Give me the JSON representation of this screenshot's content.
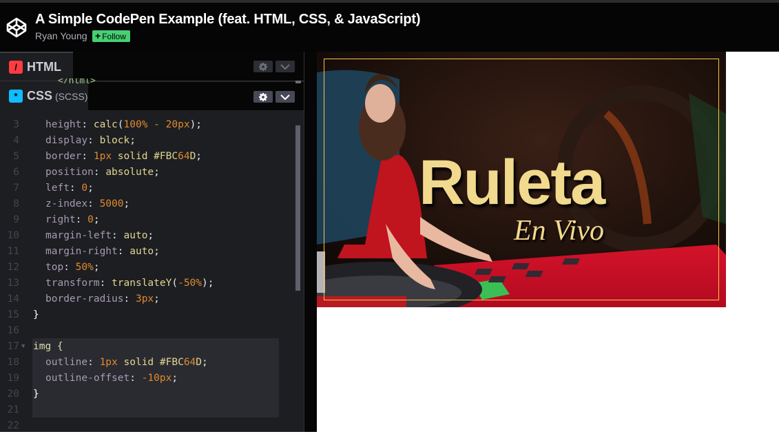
{
  "header": {
    "logo_icon": "codepen-logo-icon",
    "title": "A Simple CodePen Example (feat. HTML, CSS, & JavaScript)",
    "author": "Ryan Young",
    "follow_label": "Follow",
    "follow_icon": "plus-icon"
  },
  "panes": {
    "html": {
      "label": "HTML",
      "icon": "html-icon",
      "icon_glyph": "/",
      "icon_color": "#ff3c41",
      "peek_text": "</html>"
    },
    "css": {
      "label": "CSS",
      "sublabel": "(SCSS)",
      "icon": "css-icon",
      "icon_glyph": "*",
      "icon_color": "#0ebeff"
    }
  },
  "code": {
    "lines": [
      {
        "num": "3",
        "prop": "height",
        "value": "calc(100% - 20px);"
      },
      {
        "num": "4",
        "prop": "display",
        "value": "block;"
      },
      {
        "num": "5",
        "prop": "border",
        "value": "1px solid #FBC64D;"
      },
      {
        "num": "6",
        "prop": "position",
        "value": "absolute;"
      },
      {
        "num": "7",
        "prop": "left",
        "value": "0;"
      },
      {
        "num": "8",
        "prop": "z-index",
        "value": "5000;"
      },
      {
        "num": "9",
        "prop": "right",
        "value": "0;"
      },
      {
        "num": "10",
        "prop": "margin-left",
        "value": "auto;"
      },
      {
        "num": "11",
        "prop": "margin-right",
        "value": "auto;"
      },
      {
        "num": "12",
        "prop": "top",
        "value": "50%;"
      },
      {
        "num": "13",
        "prop": "transform",
        "value": "translateY(-50%);"
      },
      {
        "num": "14",
        "prop": "border-radius",
        "value": "3px;"
      },
      {
        "num": "15",
        "text": "}"
      },
      {
        "num": "16",
        "text": ""
      },
      {
        "num": "17",
        "text": "img {"
      },
      {
        "num": "18",
        "prop": "outline",
        "value": "1px solid #FBC64D;"
      },
      {
        "num": "19",
        "prop": "outline-offset",
        "value": "-10px;"
      },
      {
        "num": "20",
        "text": "}"
      },
      {
        "num": "21",
        "text": ""
      },
      {
        "num": "22",
        "text": ""
      }
    ]
  },
  "preview": {
    "image_alt": "Ruleta En Vivo live roulette dealer banner",
    "title_text": "Ruleta",
    "subtitle_text": "En Vivo",
    "outline_color": "#FBC64D"
  },
  "colors": {
    "follow_green": "#47cf73",
    "outline_gold": "#fbc64d"
  }
}
